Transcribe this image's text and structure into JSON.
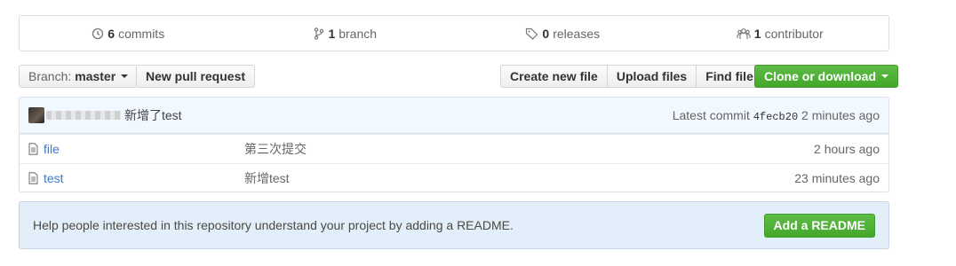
{
  "summary": {
    "commits": {
      "count": "6",
      "label": "commits",
      "icon": "history-icon"
    },
    "branches": {
      "count": "1",
      "label": "branch",
      "icon": "git-branch-icon"
    },
    "releases": {
      "count": "0",
      "label": "releases",
      "icon": "tag-icon"
    },
    "contributors": {
      "count": "1",
      "label": "contributor",
      "icon": "organization-icon"
    }
  },
  "toolbar": {
    "branch_prefix": "Branch:",
    "branch_name": "master",
    "new_pull_request": "New pull request",
    "create_new_file": "Create new file",
    "upload_files": "Upload files",
    "find_file": "Find file",
    "clone_or_download": "Clone or download"
  },
  "latest_commit": {
    "message": "新增了test",
    "prefix": "Latest commit",
    "sha": "4fecb20",
    "age": "2 minutes ago"
  },
  "files": [
    {
      "name": "file",
      "message": "第三次提交",
      "age": "2 hours ago",
      "icon": "file-text-icon"
    },
    {
      "name": "test",
      "message": "新增test",
      "age": "23 minutes ago",
      "icon": "file-text-icon"
    }
  ],
  "readme_prompt": {
    "text": "Help people interested in this repository understand your project by adding a README.",
    "button": "Add a README"
  },
  "colors": {
    "link": "#4078c0",
    "green": "#43a72a",
    "commit_bar_bg": "#f1f8ff",
    "readme_bg": "#e2eef9"
  }
}
